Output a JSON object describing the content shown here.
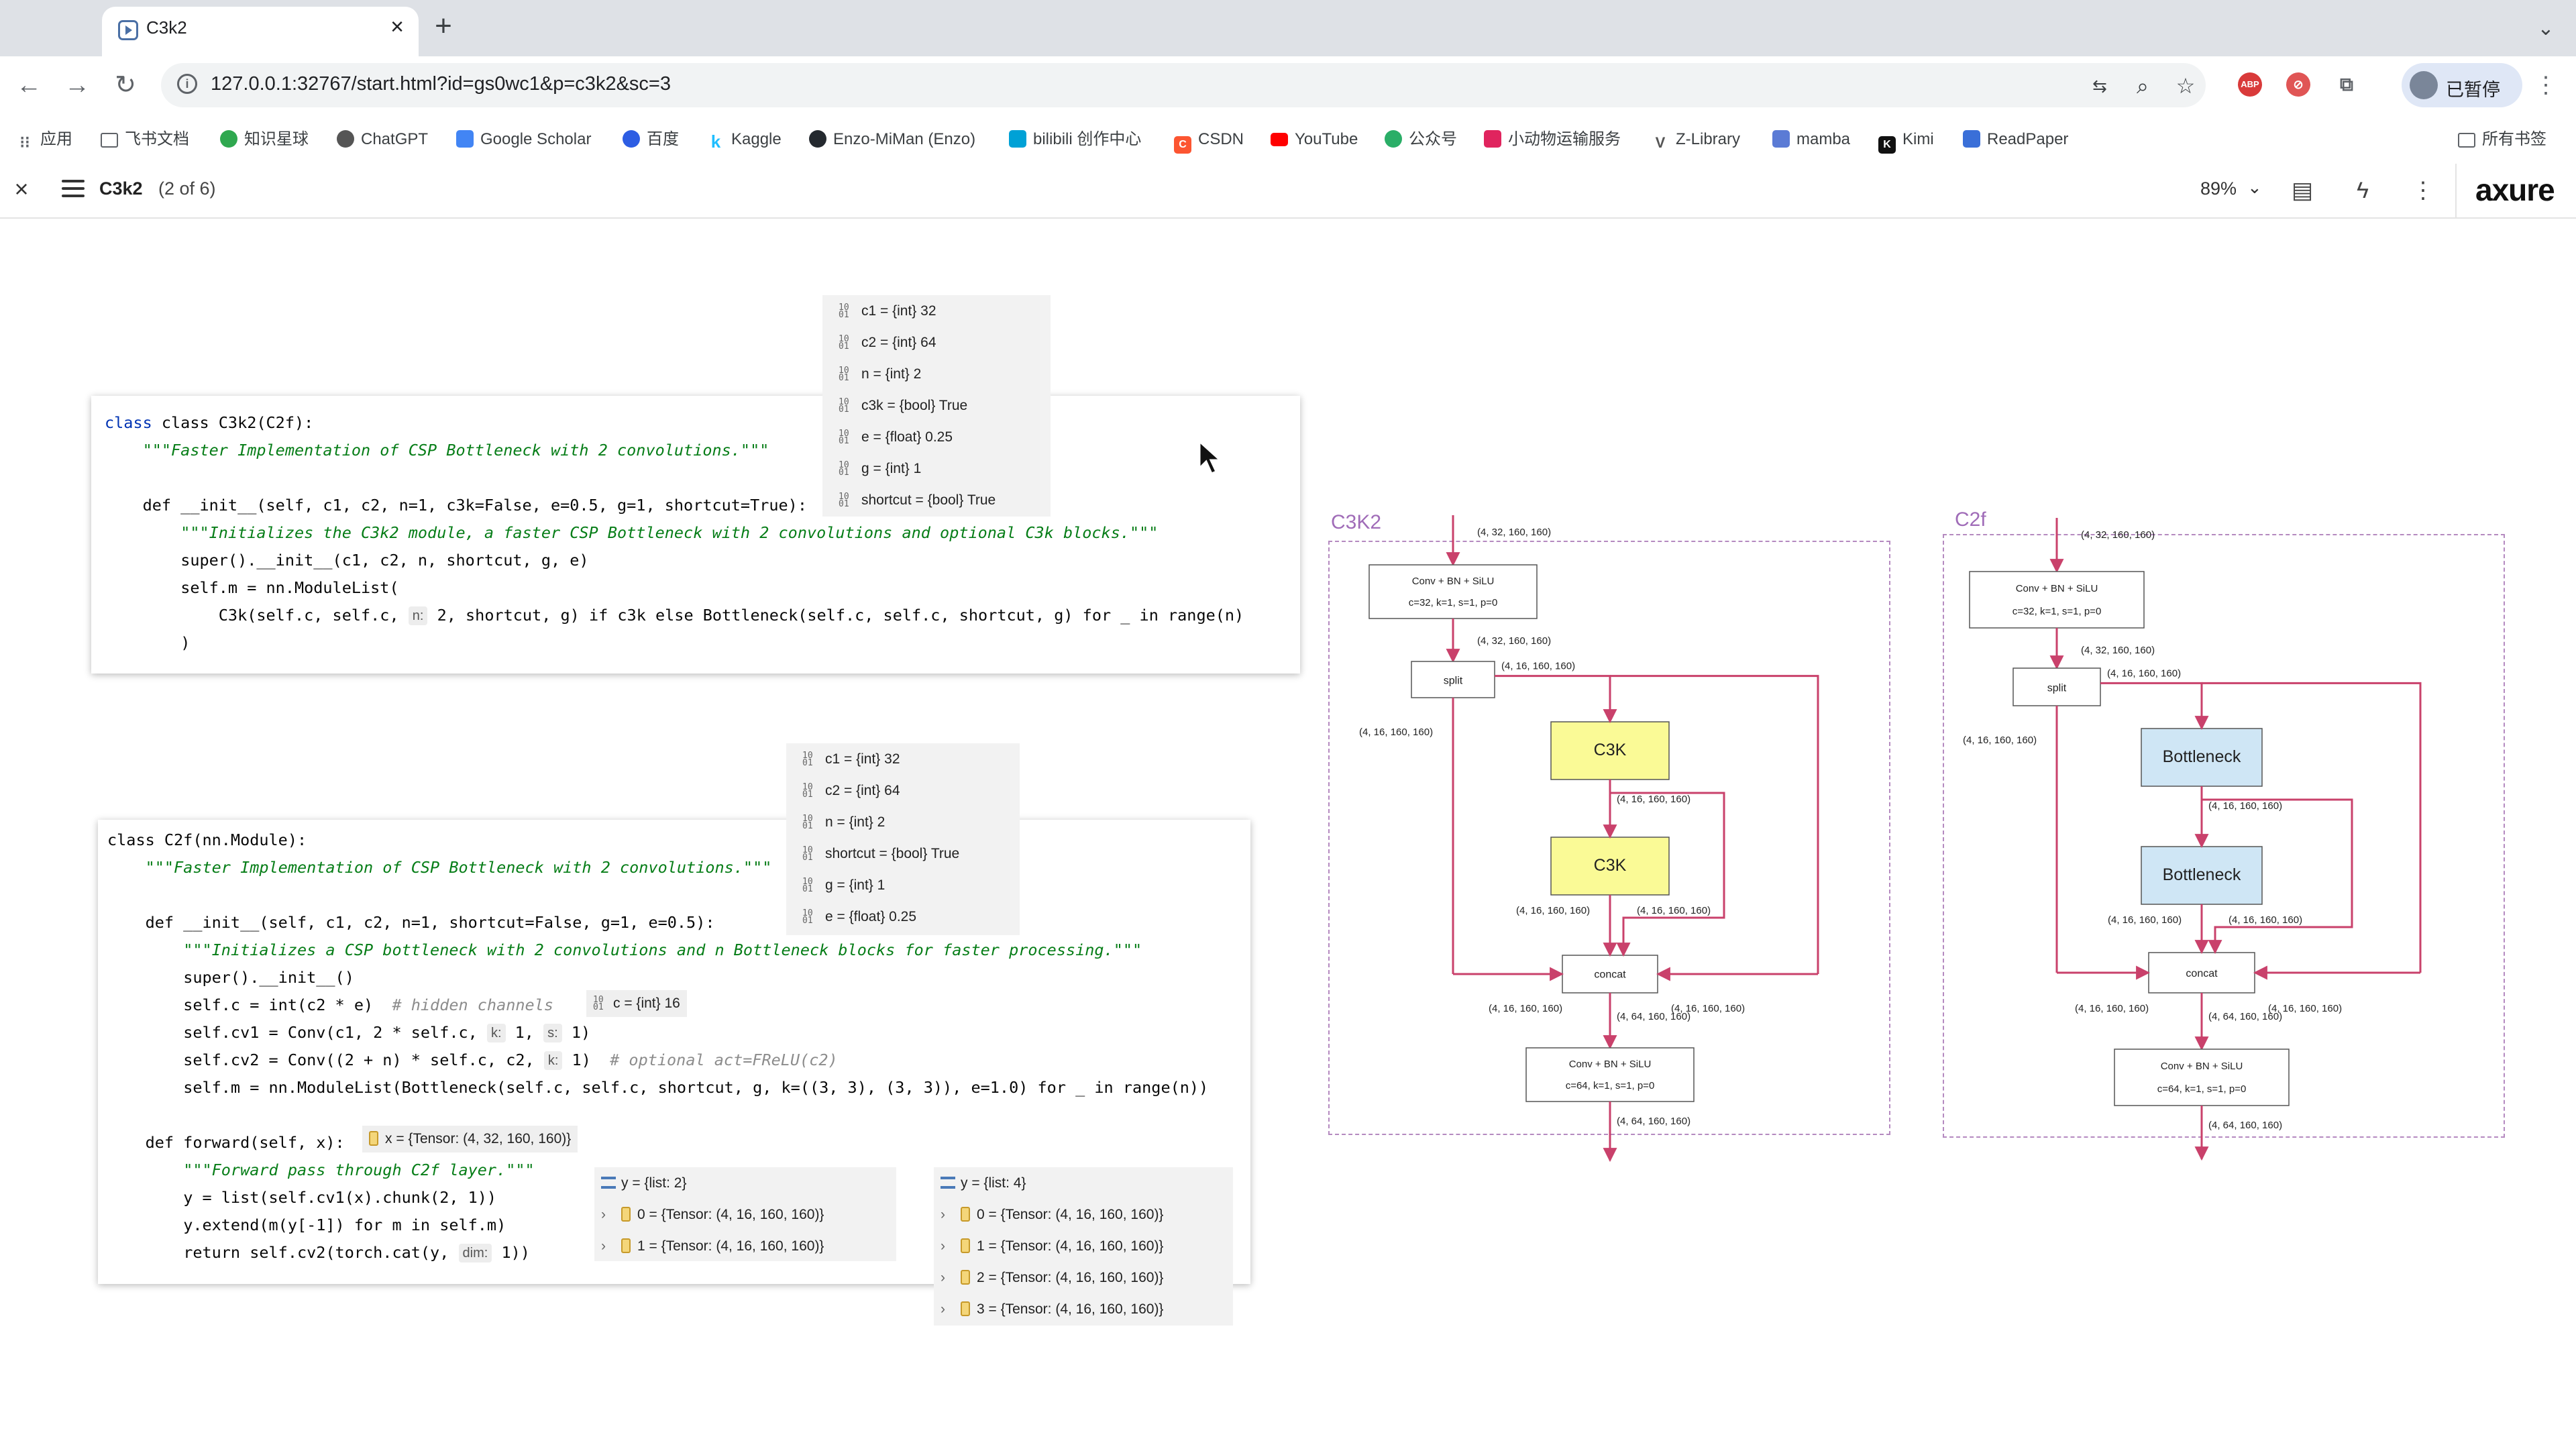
{
  "browser": {
    "tab_title": "C3k2",
    "close_tab": "×",
    "new_tab": "+",
    "url": "127.0.0.1:32767/start.html?id=gs0wc1&p=c3k2&sc=3",
    "profile_label": "已暂停",
    "bookmarks": [
      "应用",
      "飞书文档",
      "知识星球",
      "ChatGPT",
      "Google Scholar",
      "百度",
      "Kaggle",
      "Enzo-MiMan (Enzo)",
      "bilibili 创作中心",
      "CSDN",
      "YouTube",
      "公众号",
      "小动物运输服务",
      "Z-Library",
      "mamba",
      "Kimi",
      "ReadPaper"
    ],
    "all_bookmarks": "所有书签"
  },
  "axure": {
    "page_name": "C3k2",
    "page_count": "(2 of 6)",
    "zoom": "89%",
    "logo": "axure"
  },
  "code_c3k2": {
    "lines": [
      "class C3k2(C2f):",
      "\"\"\"Faster Implementation of CSP Bottleneck with 2 convolutions.\"\"\"",
      "def __init__(self, c1, c2, n=1, c3k=False, e=0.5, g=1, shortcut=True):",
      "\"\"\"Initializes the C3k2 module, a faster CSP Bottleneck with 2 convolutions and optional C3k blocks.\"\"\"",
      "super().__init__(c1, c2, n, shortcut, g, e)",
      "self.m = nn.ModuleList(",
      "C3k(self.c, self.c, ",
      "2, shortcut, g) if c3k else Bottleneck(self.c, self.c, shortcut, g) for _ in range(n)",
      ")"
    ],
    "hint_n": "n:"
  },
  "vars_c3k2": [
    "c1 = {int} 32",
    "c2 = {int} 64",
    "n = {int} 2",
    "c3k = {bool} True",
    "e = {float} 0.25",
    "g = {int} 1",
    "shortcut = {bool} True"
  ],
  "code_c2f": {
    "lines": [
      "class C2f(nn.Module):",
      "\"\"\"Faster Implementation of CSP Bottleneck with 2 convolutions.\"\"\"",
      "def __init__(self, c1, c2, n=1, shortcut=False, g=1, e=0.5):",
      "\"\"\"Initializes a CSP bottleneck with 2 convolutions and n Bottleneck blocks for faster processing.\"\"\"",
      "super().__init__()",
      "self.c = int(c2 * e)  ",
      "# hidden channels",
      "self.cv1 = Conv(c1, 2 * self.c, ",
      "1, ",
      "1)",
      "self.cv2 = Conv((2 + n) * self.c, c2, ",
      "1)  ",
      "# optional act=FReLU(c2)",
      "self.m = nn.ModuleList(Bottleneck(self.c, self.c, shortcut, g, k=((3, 3), (3, 3)), e=1.0) for _ in range(n))",
      "def forward(self, x):",
      "\"\"\"Forward pass through C2f layer.\"\"\"",
      "y = list(self.cv1(x).chunk(2, 1))",
      "y.extend(m(y[-1]) for m in self.m)",
      "return self.cv2(torch.cat(y, ",
      "1))"
    ],
    "hint_k": "k:",
    "hint_s": "s:",
    "hint_dim": "dim:"
  },
  "vars_c2f": [
    "c1 = {int} 32",
    "c2 = {int} 64",
    "n = {int} 2",
    "shortcut = {bool} True",
    "g = {int} 1",
    "e = {float} 0.25"
  ],
  "inline_c": "c = {int} 16",
  "inline_x": "x = {Tensor: (4, 32, 160, 160)}",
  "y_list2": {
    "header": "y = {list: 2}",
    "items": [
      "0 = {Tensor: (4, 16, 160, 160)}",
      "1 = {Tensor: (4, 16, 160, 160)}"
    ]
  },
  "y_list4": {
    "header": "y = {list: 4}",
    "items": [
      "0 = {Tensor: (4, 16, 160, 160)}",
      "1 = {Tensor: (4, 16, 160, 160)}",
      "2 = {Tensor: (4, 16, 160, 160)}",
      "3 = {Tensor: (4, 16, 160, 160)}"
    ]
  },
  "diagram_c3k2": {
    "title": "C3K2",
    "conv1": [
      "Conv + BN + SiLU",
      "c=32, k=1, s=1, p=0"
    ],
    "conv2": [
      "Conv + BN + SiLU",
      "c=64, k=1, s=1, p=0"
    ],
    "split": "split",
    "block": "C3K",
    "concat": "concat",
    "labels": {
      "in": "(4, 32, 160, 160)",
      "after_conv": "(4, 32, 160, 160)",
      "split_right": "(4, 16, 160, 160)",
      "split_left": "(4, 16, 160, 160)",
      "mid": "(4, 16, 160, 160)",
      "b2_left": "(4, 16, 160, 160)",
      "b2_right": "(4, 16, 160, 160)",
      "concat_left": "(4, 16, 160, 160)",
      "concat_right": "(4, 16, 160, 160)",
      "after_concat": "(4, 64, 160, 160)",
      "out": "(4, 64, 160, 160)"
    }
  },
  "diagram_c2f": {
    "title": "C2f",
    "conv1": [
      "Conv + BN + SiLU",
      "c=32, k=1, s=1, p=0"
    ],
    "conv2": [
      "Conv + BN + SiLU",
      "c=64, k=1, s=1, p=0"
    ],
    "split": "split",
    "block": "Bottleneck",
    "concat": "concat",
    "labels": {
      "in": "(4, 32, 160, 160)",
      "after_conv": "(4, 32, 160, 160)",
      "split_right": "(4, 16, 160, 160)",
      "split_left": "(4, 16, 160, 160)",
      "mid": "(4, 16, 160, 160)",
      "b2_left": "(4, 16, 160, 160)",
      "b2_right": "(4, 16, 160, 160)",
      "concat_left": "(4, 16, 160, 160)",
      "concat_right": "(4, 16, 160, 160)",
      "after_concat": "(4, 64, 160, 160)",
      "out": "(4, 64, 160, 160)"
    }
  },
  "colors": {
    "arrow": "#c9416b",
    "c3k_fill": "#fafa96",
    "bottleneck_fill": "#cfe6f5",
    "dashed_border": "#b58ac0"
  }
}
